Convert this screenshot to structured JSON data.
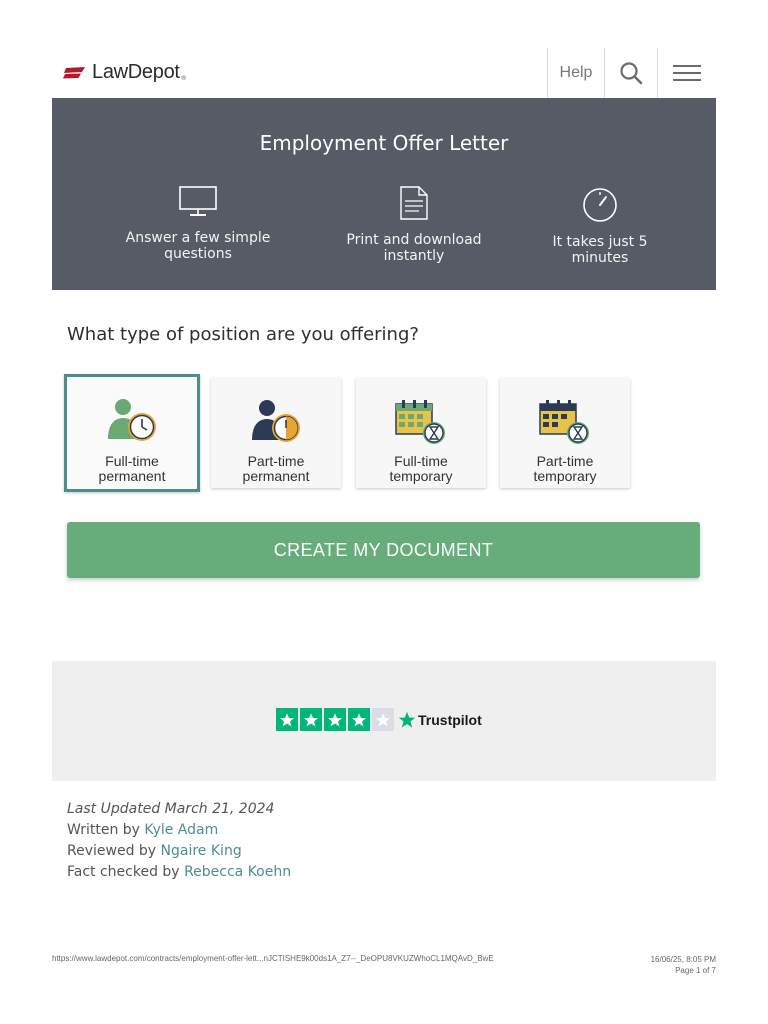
{
  "header": {
    "logo_text": "LawDepot",
    "logo_tm": "®",
    "help_label": "Help",
    "icons": [
      "search-icon",
      "hamburger-menu-icon"
    ]
  },
  "hero": {
    "title": "Employment Offer Letter",
    "features": [
      {
        "icon": "monitor-icon",
        "label": "Answer a few simple questions"
      },
      {
        "icon": "document-icon",
        "label": "Print and download instantly"
      },
      {
        "icon": "stopwatch-icon",
        "label": "It takes just 5 minutes"
      }
    ]
  },
  "question": "What type of position are you offering?",
  "options": [
    {
      "line1": "Full-time",
      "line2": "permanent",
      "icon": "person-clock-icon",
      "selected": true
    },
    {
      "line1": "Part-time",
      "line2": "permanent",
      "icon": "person-half-clock-icon",
      "selected": false
    },
    {
      "line1": "Full-time",
      "line2": "temporary",
      "icon": "calendar-hourglass-icon",
      "selected": false
    },
    {
      "line1": "Part-time",
      "line2": "temporary",
      "icon": "calendar-half-hourglass-icon",
      "selected": false
    }
  ],
  "cta_label": "CREATE MY DOCUMENT",
  "trustpilot": {
    "label": "Trustpilot",
    "rating_stars": 4,
    "max_stars": 5
  },
  "meta": {
    "last_updated": "Last Updated March 21, 2024",
    "written_prefix": "Written by",
    "written_name": "Kyle Adam",
    "reviewed_prefix": "Reviewed by",
    "reviewed_name": "Ngaire King",
    "checked_prefix": "Fact checked by",
    "checked_name": "Rebecca Koehn"
  },
  "print_footer": {
    "url": "https://www.lawdepot.com/contracts/employment-offer-lett...nJCTISHE9k00ds1A_Z7--_DeOPU8VKUZWhoCL1MQAvD_BwE",
    "datetime": "16/06/25, 8:05 PM",
    "page": "Page 1 of 7"
  },
  "colors": {
    "hero_bg": "#575b66",
    "cta_green": "#66ad7b",
    "link_teal": "#4e8e8f",
    "selected_border": "#4e8d8b",
    "trustpilot_green": "#00b67a",
    "logo_red": "#b5172f"
  }
}
